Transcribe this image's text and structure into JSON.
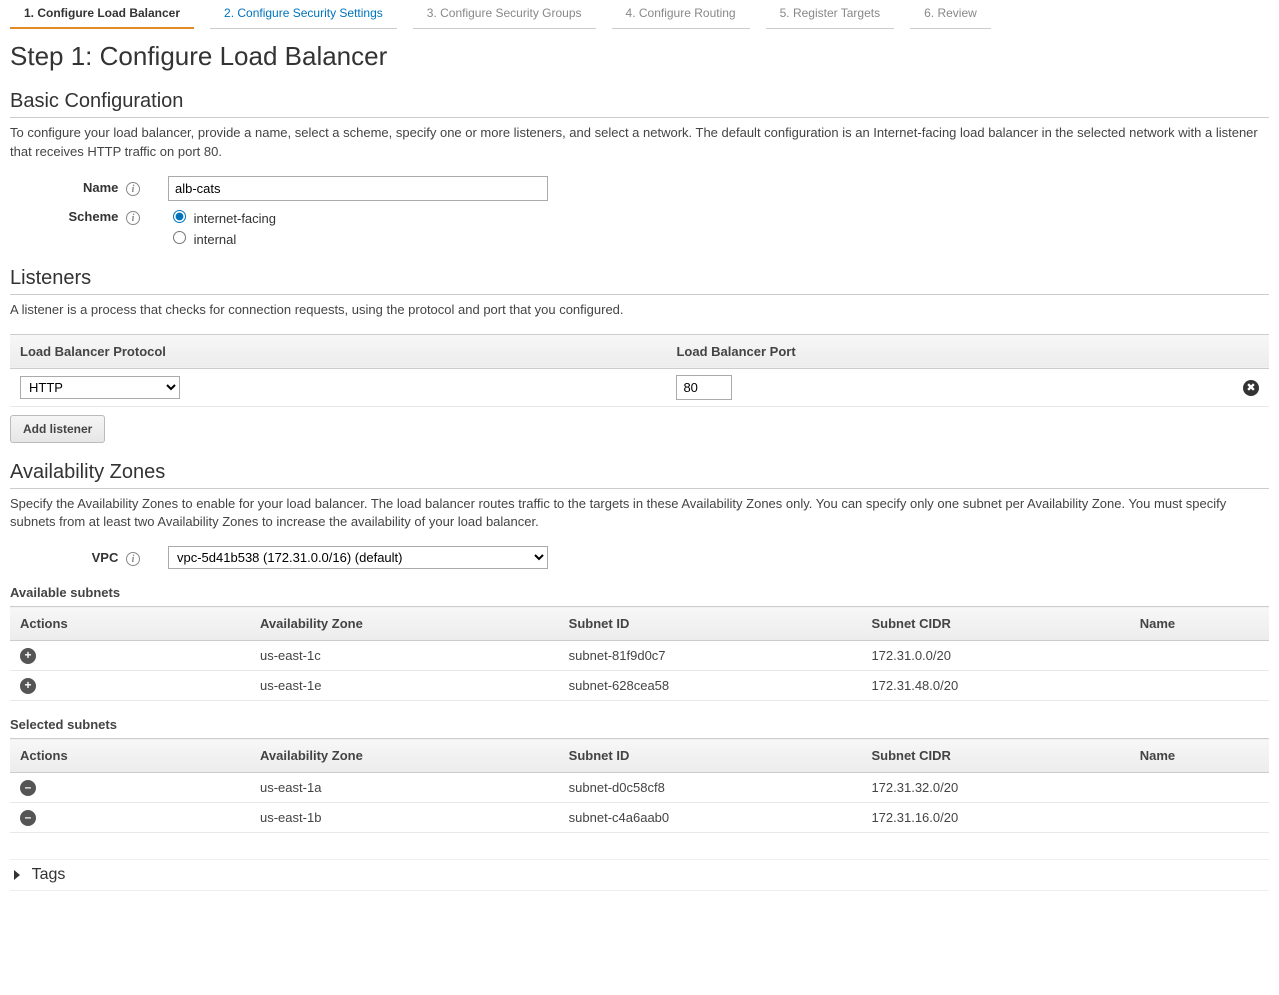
{
  "wizard": {
    "steps": [
      {
        "label": "1. Configure Load Balancer",
        "active": true
      },
      {
        "label": "2. Configure Security Settings",
        "link": true
      },
      {
        "label": "3. Configure Security Groups"
      },
      {
        "label": "4. Configure Routing"
      },
      {
        "label": "5. Register Targets"
      },
      {
        "label": "6. Review"
      }
    ]
  },
  "page_title": "Step 1: Configure Load Balancer",
  "basic": {
    "heading": "Basic Configuration",
    "description": "To configure your load balancer, provide a name, select a scheme, specify one or more listeners, and select a network. The default configuration is an Internet-facing load balancer in the selected network with a listener that receives HTTP traffic on port 80.",
    "name_label": "Name",
    "name_value": "alb-cats",
    "scheme_label": "Scheme",
    "scheme_options": {
      "internet_facing": "internet-facing",
      "internal": "internal"
    },
    "scheme_selected": "internet-facing"
  },
  "listeners": {
    "heading": "Listeners",
    "description": "A listener is a process that checks for connection requests, using the protocol and port that you configured.",
    "cols": {
      "protocol": "Load Balancer Protocol",
      "port": "Load Balancer Port"
    },
    "rows": [
      {
        "protocol": "HTTP",
        "port": "80"
      }
    ],
    "add_button": "Add listener"
  },
  "az": {
    "heading": "Availability Zones",
    "description": "Specify the Availability Zones to enable for your load balancer. The load balancer routes traffic to the targets in these Availability Zones only. You can specify only one subnet per Availability Zone. You must specify subnets from at least two Availability Zones to increase the availability of your load balancer.",
    "vpc_label": "VPC",
    "vpc_value": "vpc-5d41b538 (172.31.0.0/16) (default)",
    "available_title": "Available subnets",
    "selected_title": "Selected subnets",
    "cols": {
      "actions": "Actions",
      "az": "Availability Zone",
      "subnet_id": "Subnet ID",
      "cidr": "Subnet CIDR",
      "name": "Name"
    },
    "available": [
      {
        "az": "us-east-1c",
        "subnet_id": "subnet-81f9d0c7",
        "cidr": "172.31.0.0/20",
        "name": ""
      },
      {
        "az": "us-east-1e",
        "subnet_id": "subnet-628cea58",
        "cidr": "172.31.48.0/20",
        "name": ""
      }
    ],
    "selected": [
      {
        "az": "us-east-1a",
        "subnet_id": "subnet-d0c58cf8",
        "cidr": "172.31.32.0/20",
        "name": ""
      },
      {
        "az": "us-east-1b",
        "subnet_id": "subnet-c4a6aab0",
        "cidr": "172.31.16.0/20",
        "name": ""
      }
    ]
  },
  "tags": {
    "label": "Tags"
  }
}
